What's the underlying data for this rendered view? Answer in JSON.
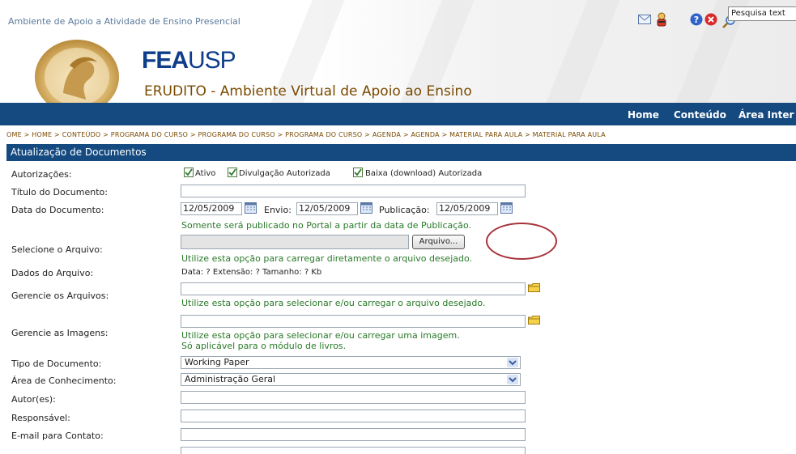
{
  "header": {
    "top_text": "Ambiente de Apoio a Atividade de Ensino Presencial",
    "brand_fea": "FEA",
    "brand_usp": "USP",
    "subtitle": "ERUDITO - Ambiente Virtual de Apoio ao Ensino",
    "search_label": "Pesquisa text",
    "icons": [
      "mail-icon",
      "user-icon",
      "help-icon",
      "close-icon",
      "search-icon"
    ]
  },
  "nav": {
    "home": "Home",
    "conteudo": "Conteúdo",
    "area": "Área Inter"
  },
  "breadcrumb": "OME  >  HOME  >  CONTEÚDO  >  PROGRAMA DO CURSO  >  PROGRAMA DO CURSO  >  PROGRAMA DO CURSO  >  AGENDA  >  AGENDA  >  MATERIAL PARA AULA  >  MATERIAL PARA AULA",
  "page_title": "Atualização de Documentos",
  "form": {
    "autorizacoes_label": "Autorizações:",
    "chk_ativo": "Ativo",
    "chk_divulgacao": "Divulgação Autorizada",
    "chk_baixa": "Baixa (download) Autorizada",
    "titulo_label": "Título do Documento:",
    "data_label": "Data do Documento:",
    "data_value": "12/05/2009",
    "envio_label": "Envio:",
    "envio_value": "12/05/2009",
    "publicacao_label": "Publicação:",
    "publicacao_value": "12/05/2009",
    "data_help": "Somente será publicado no Portal a partir da data de Publicação.",
    "arquivo_label": "Selecione o Arquivo:",
    "arquivo_button": "Arquivo...",
    "arquivo_help": "Utilize esta opção para carregar diretamente o arquivo desejado.",
    "dados_label": "Dados do Arquivo:",
    "dados_value": "Data:  ? Extensão: ? Tamanho:  ? Kb",
    "gerencie_arquivos_label": "Gerencie os Arquivos:",
    "gerencie_arquivos_help": "Utilize esta opção para selecionar e/ou carregar o arquivo desejado.",
    "gerencie_imagens_label": "Gerencie as Imagens:",
    "gerencie_imagens_help1": "Utilize esta opção para selecionar e/ou carregar uma imagem.",
    "gerencie_imagens_help2": "Só aplicável para o módulo de livros.",
    "tipo_label": "Tipo de Documento:",
    "tipo_value": "Working Paper",
    "area_label": "Área de Conhecimento:",
    "area_value": "Administração Geral",
    "autor_label": "Autor(es):",
    "responsavel_label": "Responsável:",
    "email_label": "E-mail para Contato:"
  },
  "colors": {
    "navy": "#144a80",
    "help_green": "#2a7a2a",
    "annotation": "#a8313a"
  }
}
